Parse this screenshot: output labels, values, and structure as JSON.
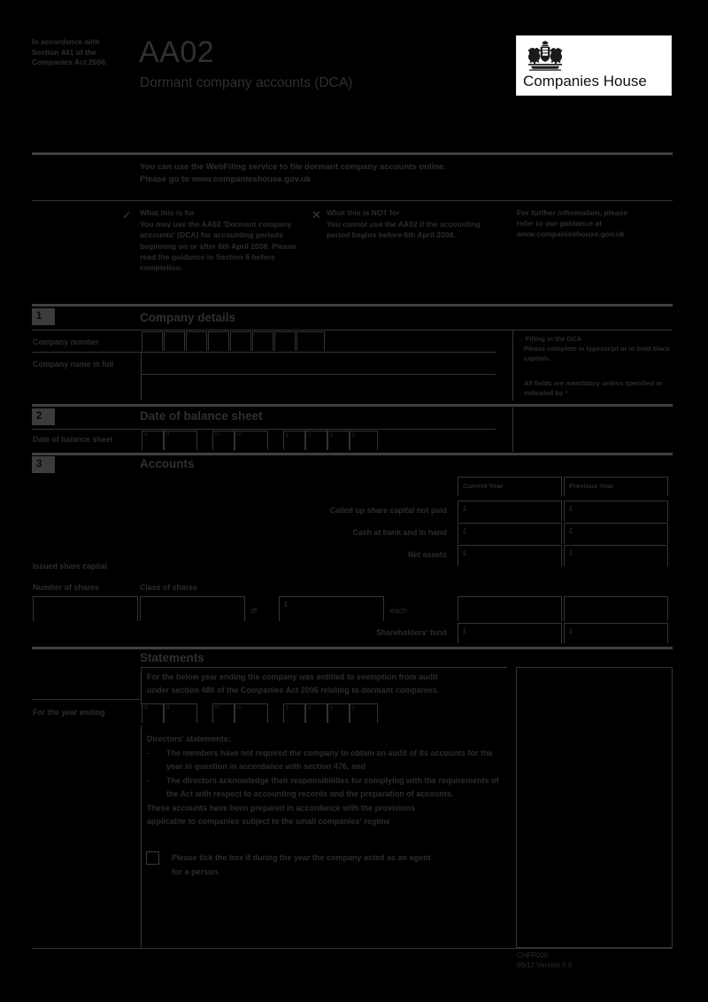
{
  "header": {
    "accordance_note": "In accordance with Section 441 of the Companies Act 2006.",
    "form_code": "AA02",
    "form_subtitle": "Dormant company accounts (DCA)",
    "logo_text": "Companies House",
    "logo_crest_icon": "royal-coat-of-arms-icon"
  },
  "webfiling": {
    "line1": "You can use the WebFiling service to file dormant company accounts online.",
    "line2": "Please go to www.companieshouse.gov.uk"
  },
  "notices": {
    "for": {
      "icon": "tick-icon",
      "heading": "What this is for",
      "body": "You may use the AA02 'Dormant company accounts' (DCA) for accounting periods beginning on or after 6th April 2008. Please read the guidance in Section 6 before completion."
    },
    "not_for": {
      "icon": "cross-icon",
      "heading": "What this is NOT for",
      "body": "You cannot use the AA02 if the accounting period begins before 6th April 2008."
    },
    "further": {
      "line1": "For further information, please",
      "line2": "refer to our guidance at",
      "line3": "www.companieshouse.gov.uk"
    }
  },
  "section1": {
    "number": "1",
    "title": "Company details",
    "company_number_label": "Company number",
    "company_number_boxes": 8,
    "company_name_label": "Company name in full",
    "company_number_value": "",
    "company_name_line1": "",
    "company_name_line2": ""
  },
  "sidenotes": {
    "arrow_icon": "arrow-right-icon",
    "note1_heading": "Filling in the DCA",
    "note1_body": "Please complete in typescript or in bold black capitals.",
    "note2_body": "All fields are mandatory unless specified or indicated by *"
  },
  "section2": {
    "number": "2",
    "title": "Date of balance sheet",
    "label": "Date of balance sheet",
    "date_hints": [
      "d",
      "d",
      "m",
      "m",
      "y",
      "y",
      "y",
      "y"
    ],
    "date_values": [
      "",
      "",
      "",
      "",
      "",
      "",
      "",
      ""
    ]
  },
  "section3": {
    "number": "3",
    "title": "Accounts",
    "col_current": "Current Year",
    "col_previous": "Previous Year",
    "currency_symbol": "£",
    "rows": [
      {
        "label": "Called up share capital not paid",
        "current": "",
        "previous": ""
      },
      {
        "label": "Cash at bank and in hand",
        "current": "",
        "previous": ""
      },
      {
        "label": "Net assets",
        "current": "",
        "previous": ""
      }
    ],
    "issued_share_capital_title": "Issued share capital",
    "number_of_shares_label": "Number of shares",
    "class_of_shares_label": "Class of shares",
    "of_label": "of",
    "each_label": "each",
    "number_of_shares_value": "",
    "class_of_shares_value": "",
    "nominal_value": "",
    "shareholders_fund_label": "Shareholders' fund",
    "shareholders_fund_current": "",
    "shareholders_fund_previous": ""
  },
  "statements": {
    "title": "Statements",
    "exemption_line1": "For the below year ending the company was entitled to exemption from audit",
    "exemption_line2": "under section 480 of the Companies Act 2006 relating to dormant companies.",
    "year_ending_label": "For the year ending",
    "date_hints": [
      "d",
      "d",
      "m",
      "m",
      "y",
      "y",
      "y",
      "y"
    ],
    "date_values": [
      "",
      "",
      "",
      "",
      "",
      "",
      "",
      ""
    ],
    "directors_heading": "Directors' statements:",
    "bullet_marker": "-",
    "bullet1": "The members have not required the company to obtain an audit of its accounts for the year in question in accordance with section 476, and",
    "bullet2": "The directors acknowledge their responsibilities for complying with the requirements of the Act with respect to accounting records and the preparation of accounts.",
    "closing_line1": "These accounts have been prepared in accordance with the provisions",
    "closing_line2": "applicable to companies subject to the small companies' regime",
    "agent_checkbox_checked": false,
    "agent_text_line1": "Please tick the box if during the year the company acted as an agent",
    "agent_text_line2": "for a person."
  },
  "footer": {
    "code": "CHFP000",
    "version": "05/12 Version 5.0"
  },
  "colors": {
    "background": "#000000",
    "text": "#2b2b2b",
    "rule": "#3a3a3a",
    "logo_background": "#ffffff"
  }
}
